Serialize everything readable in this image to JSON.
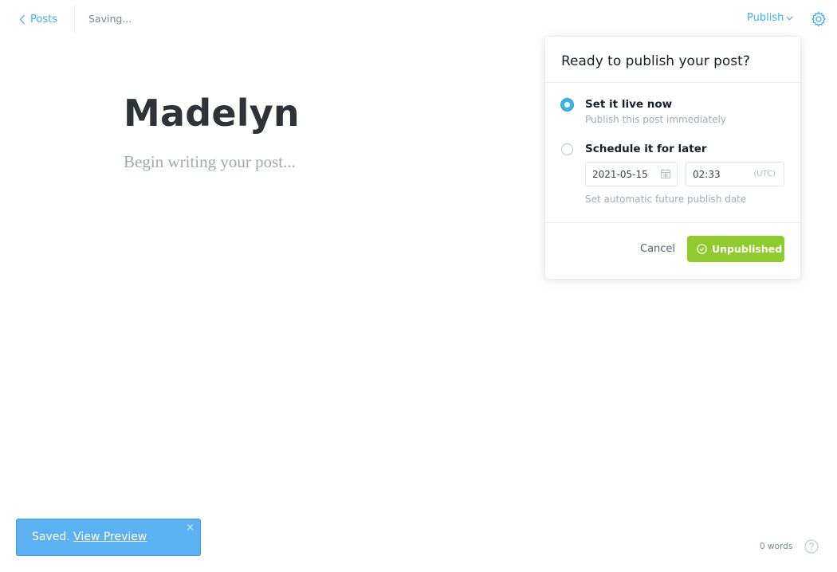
{
  "header": {
    "back_label": "Posts",
    "status": "Saving...",
    "publish_label": "Publish"
  },
  "editor": {
    "title": "Madelyn",
    "body_placeholder": "Begin writing your post..."
  },
  "publish_menu": {
    "heading": "Ready to publish your post?",
    "options": [
      {
        "label": "Set it live now",
        "description": "Publish this post immediately",
        "selected": true
      },
      {
        "label": "Schedule it for later",
        "selected": false
      }
    ],
    "schedule": {
      "date": "2021-05-15",
      "time": "02:33",
      "timezone": "(UTC)",
      "hint": "Set automatic future publish date"
    },
    "cancel_label": "Cancel",
    "action_label": "Unpublished"
  },
  "toast": {
    "message": "Saved.",
    "link": "View Preview",
    "close": "×"
  },
  "footer": {
    "word_count": "0 words"
  },
  "icons": {
    "back": "chevron-left-icon",
    "publish_caret": "chevron-down-icon",
    "settings": "gear-icon",
    "calendar": "calendar-icon",
    "action": "check-circle-icon",
    "help": "help-circle-icon"
  },
  "colors": {
    "accent_blue": "#3eb0ef",
    "publish_green": "#8fcb2c",
    "toast_blue": "#5ab2f3"
  }
}
